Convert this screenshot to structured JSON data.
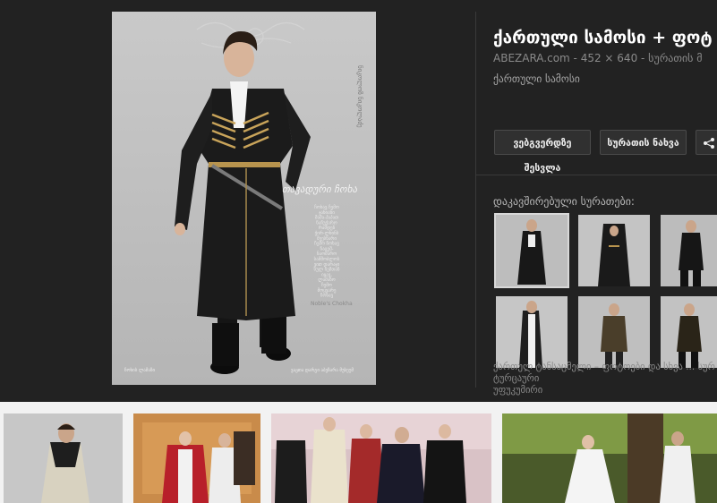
{
  "detail": {
    "title": "ქართული სამოსი + ფოტ",
    "meta": "ABEZARA.com - 452 × 640 - სურათის მ",
    "description": "ქართული სამოსი",
    "visit_page_label": "ვებგვერდზე შესვლა",
    "view_image_label": "სურათის ნახვა",
    "share_icon": "share-icon",
    "related_label": "დაკავშირებული სურათები:",
    "related_caption": "ქართულ ტანსაცმელი – ფოტოები და სხვა ... სურ ტურცაური",
    "related_caption_2": "უფუკუმირი"
  },
  "preview": {
    "brand_vertical": "ნიკოლოზ ნიკოლაძე",
    "title_text": "თავადური ჩოხა",
    "poem_lines": [
      "ჩოხავ ჩემო",
      "ჯანიანი",
      "მამა-პაპათ",
      "ნაჩუქარო",
      "რამდენ",
      "ჭირ-ლხინს",
      "შეესწარი",
      "ჩემო ჩოხავ",
      "ნაცემ-",
      "ნაომარო",
      "სამშობლოს",
      "ვით დარაჯი",
      "სულ ჩემთან",
      "იყავ,",
      "ლამაზო",
      "ჩემო",
      "მოყვარე",
      "ჩოხავ"
    ],
    "poem_credit": "Noble's Chokha",
    "footer_left": "ჩოხის ლამაზი",
    "footer_right": "ვაჟთა დარგი აბეზარა მუსეუმ"
  },
  "colors": {
    "panel_bg": "#222222",
    "page_bg": "#f2f2f2",
    "button_bg": "#303030",
    "title": "#ffffff"
  }
}
